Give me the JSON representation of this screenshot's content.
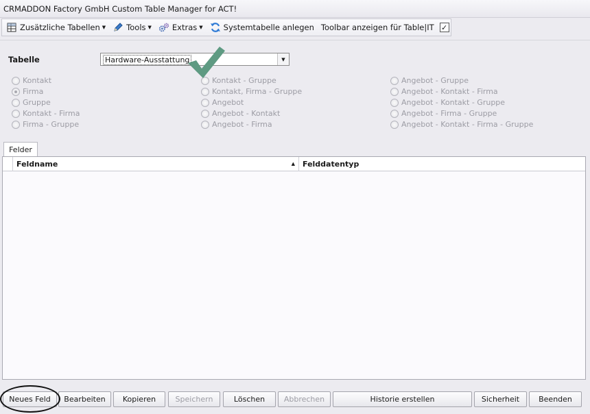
{
  "window": {
    "title": "CRMADDON Factory GmbH Custom Table Manager for ACT!"
  },
  "toolbar": {
    "items": [
      {
        "label": "Zusätzliche Tabellen",
        "icon": "table-icon",
        "dropdown": true
      },
      {
        "label": "Tools",
        "icon": "pencil-icon",
        "dropdown": true
      },
      {
        "label": "Extras",
        "icon": "gears-icon",
        "dropdown": true
      },
      {
        "label": "Systemtabelle anlegen",
        "icon": "refresh-icon",
        "dropdown": false
      },
      {
        "label": "Toolbar anzeigen für Table|IT",
        "icon": "",
        "dropdown": false
      }
    ],
    "checkbox_checked": true
  },
  "table_selector": {
    "label": "Tabelle",
    "value": "Hardware-Ausstattung"
  },
  "radio_options": {
    "col1": [
      "Kontakt",
      "Firma",
      "Gruppe",
      "Kontakt - Firma",
      "Firma - Gruppe"
    ],
    "col2": [
      "Kontakt - Gruppe",
      "Kontakt, Firma - Gruppe",
      "Angebot",
      "Angebot - Kontakt",
      "Angebot - Firma"
    ],
    "col3": [
      "Angebot - Gruppe",
      "Angebot - Kontakt - Firma",
      "Angebot - Kontakt - Gruppe",
      "Angebot - Firma - Gruppe",
      "Angebot - Kontakt - Firma - Gruppe"
    ],
    "selected": "Firma"
  },
  "tabs": {
    "felder": "Felder"
  },
  "grid": {
    "columns": [
      "Feldname",
      "Felddatentyp"
    ],
    "sort_column": "Feldname",
    "sort_direction": "ascending",
    "rows": []
  },
  "buttons": {
    "neues_feld": "Neues Feld",
    "bearbeiten": "Bearbeiten",
    "kopieren": "Kopieren",
    "speichern": "Speichern",
    "loeschen": "Löschen",
    "abbrechen": "Abbrechen",
    "historie": "Historie erstellen",
    "sicherheit": "Sicherheit",
    "beenden": "Beenden"
  },
  "colors": {
    "checkmark": "#5e9a82",
    "disabled_text": "#9c9ca4"
  }
}
